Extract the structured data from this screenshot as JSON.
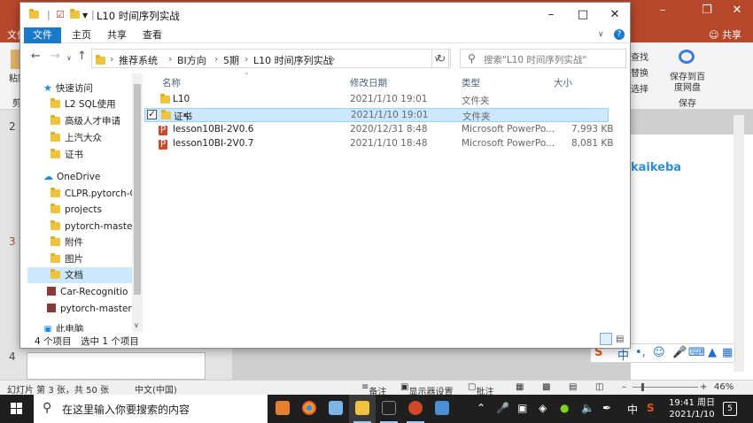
{
  "ppt": {
    "file_tab": "文件",
    "share": "共享",
    "ribbon_labels": {
      "paste": "粘贴",
      "cut": "剪",
      "find": "查找",
      "replace": "替换",
      "select": "选择",
      "save_to_cloud": "保存到百度网盘",
      "save": "保存"
    },
    "slide_numbers": [
      "2",
      "3",
      "4"
    ],
    "slide_brand": "kaikeba",
    "status": {
      "slide_info": "幻灯片 第 3 张，共 50 张",
      "language": "中文(中国)",
      "notes": "备注",
      "display_settings": "显示器设置",
      "comments": "批注",
      "zoom": "46%"
    },
    "ime": {
      "mode": "中"
    }
  },
  "explorer": {
    "title": "L10 时间序列实战",
    "ribbon_tabs": [
      "文件",
      "主页",
      "共享",
      "查看"
    ],
    "breadcrumb": [
      "推荐系统",
      "BI方向",
      "5期",
      "L10 时间序列实战"
    ],
    "search_placeholder": "搜索\"L10 时间序列实战\"",
    "columns": {
      "name": "名称",
      "modified": "修改日期",
      "type": "类型",
      "size": "大小"
    },
    "files": [
      {
        "name": "L10",
        "modified": "2021/1/10 19:01",
        "type": "文件夹",
        "size": "",
        "kind": "folder"
      },
      {
        "name": "证书",
        "modified": "2021/1/10 19:01",
        "type": "文件夹",
        "size": "",
        "kind": "folder"
      },
      {
        "name": "lesson10BI-2V0.6",
        "modified": "2020/12/31 8:48",
        "type": "Microsoft PowerPo...",
        "size": "7,993 KB",
        "kind": "pptx"
      },
      {
        "name": "lesson10BI-2V0.7",
        "modified": "2021/1/10 18:48",
        "type": "Microsoft PowerPo...",
        "size": "8,081 KB",
        "kind": "pptx"
      }
    ],
    "selected_row": 1,
    "nav": {
      "quick_access": "快速访问",
      "quick_items": [
        "L2 SQL使用",
        "高级人才申请",
        "上汽大众",
        "证书"
      ],
      "onedrive": "OneDrive",
      "onedrive_items": [
        "CLPR.pytorch-C",
        "projects",
        "pytorch-master",
        "附件",
        "图片",
        "文档",
        "Car-Recognitio",
        "pytorch-master"
      ],
      "this_pc": "此电脑"
    },
    "status": {
      "count": "4 个项目",
      "selected": "选中 1 个项目"
    }
  },
  "taskbar": {
    "search_placeholder": "在这里输入你要搜索的内容",
    "ime": "中",
    "time": "19:41 周日",
    "date": "2021/1/10",
    "notifications": "5"
  }
}
